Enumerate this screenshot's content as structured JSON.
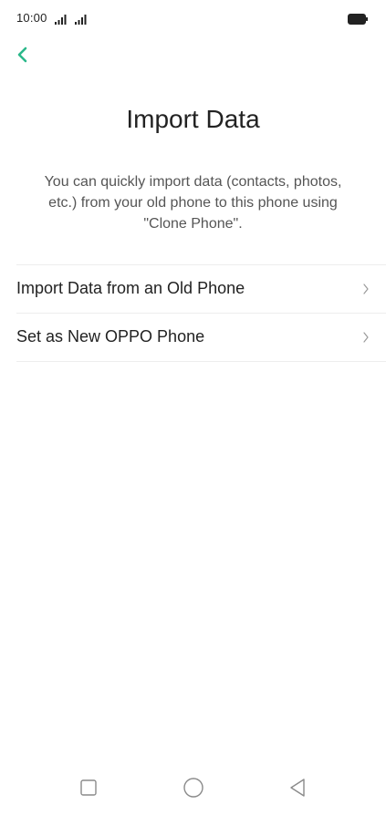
{
  "status_bar": {
    "time": "10:00",
    "icons": [
      "signal-icon",
      "signal-icon",
      "battery-icon"
    ]
  },
  "header": {
    "back_icon": "chevron-left-icon",
    "accent_color": "#2bb88a"
  },
  "main": {
    "title": "Import Data",
    "description": "You can quickly import data (contacts, photos, etc.) from your old phone to this phone using \"Clone Phone\".",
    "options": [
      {
        "label": "Import Data from an Old Phone",
        "icon": "chevron-right-icon"
      },
      {
        "label": "Set as New OPPO Phone",
        "icon": "chevron-right-icon"
      }
    ]
  },
  "nav_bar": {
    "icons": [
      "recent-apps-icon",
      "home-icon",
      "back-icon"
    ]
  }
}
